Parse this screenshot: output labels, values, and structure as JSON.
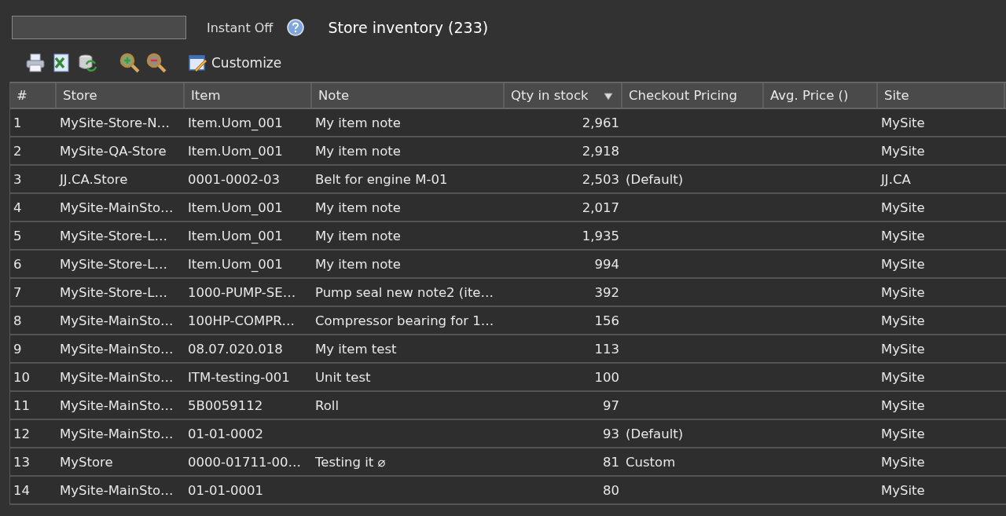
{
  "instant_toggle": {
    "label": "Instant Off"
  },
  "title": "Store inventory (233)",
  "toolbar": {
    "customize": "Customize"
  },
  "table": {
    "columns": [
      {
        "label": "#",
        "sorted": false
      },
      {
        "label": "Store",
        "sorted": false
      },
      {
        "label": "Item",
        "sorted": false
      },
      {
        "label": "Note",
        "sorted": false
      },
      {
        "label": "Qty in stock",
        "sorted": true
      },
      {
        "label": "Checkout Pricing",
        "sorted": false
      },
      {
        "label": "Avg. Price ()",
        "sorted": false
      },
      {
        "label": "Site",
        "sorted": false
      }
    ],
    "rows": [
      [
        "1",
        "MySite-Store-N…",
        "Item.Uom_001",
        "My item note",
        "2,961",
        "",
        "",
        "MySite"
      ],
      [
        "2",
        "MySite-QA-Store",
        "Item.Uom_001",
        "My item note",
        "2,918",
        "",
        "",
        "MySite"
      ],
      [
        "3",
        "JJ.CA.Store",
        "0001-0002-03",
        "Belt for engine M-01",
        "2,503",
        "(Default)",
        "",
        "JJ.CA"
      ],
      [
        "4",
        "MySite-MainSto…",
        "Item.Uom_001",
        "My item note",
        "2,017",
        "",
        "",
        "MySite"
      ],
      [
        "5",
        "MySite-Store-L…",
        "Item.Uom_001",
        "My item note",
        "1,935",
        "",
        "",
        "MySite"
      ],
      [
        "6",
        "MySite-Store-L…",
        "Item.Uom_001",
        "My item note",
        "994",
        "",
        "",
        "MySite"
      ],
      [
        "7",
        "MySite-Store-L…",
        "1000-PUMP-SE…",
        "Pump seal new note2 (ite…",
        "392",
        "",
        "",
        "MySite"
      ],
      [
        "8",
        "MySite-MainSto…",
        "100HP-COMPR…",
        "Compressor bearing for 1…",
        "156",
        "",
        "",
        "MySite"
      ],
      [
        "9",
        "MySite-MainSto…",
        "08.07.020.018",
        "My item test",
        "113",
        "",
        "",
        "MySite"
      ],
      [
        "10",
        "MySite-MainSto…",
        "ITM-testing-001",
        "Unit test",
        "100",
        "",
        "",
        "MySite"
      ],
      [
        "11",
        "MySite-MainSto…",
        "5B0059112",
        "Roll",
        "97",
        "",
        "",
        "MySite"
      ],
      [
        "12",
        "MySite-MainSto…",
        "01-01-0002",
        "",
        "93",
        "(Default)",
        "",
        "MySite"
      ],
      [
        "13",
        "MyStore",
        "0000-01711-00…",
        "Testing it ⌀",
        "81",
        "Custom",
        "",
        "MySite"
      ],
      [
        "14",
        "MySite-MainSto…",
        "01-01-0001",
        "",
        "80",
        "",
        "",
        "MySite"
      ]
    ]
  }
}
